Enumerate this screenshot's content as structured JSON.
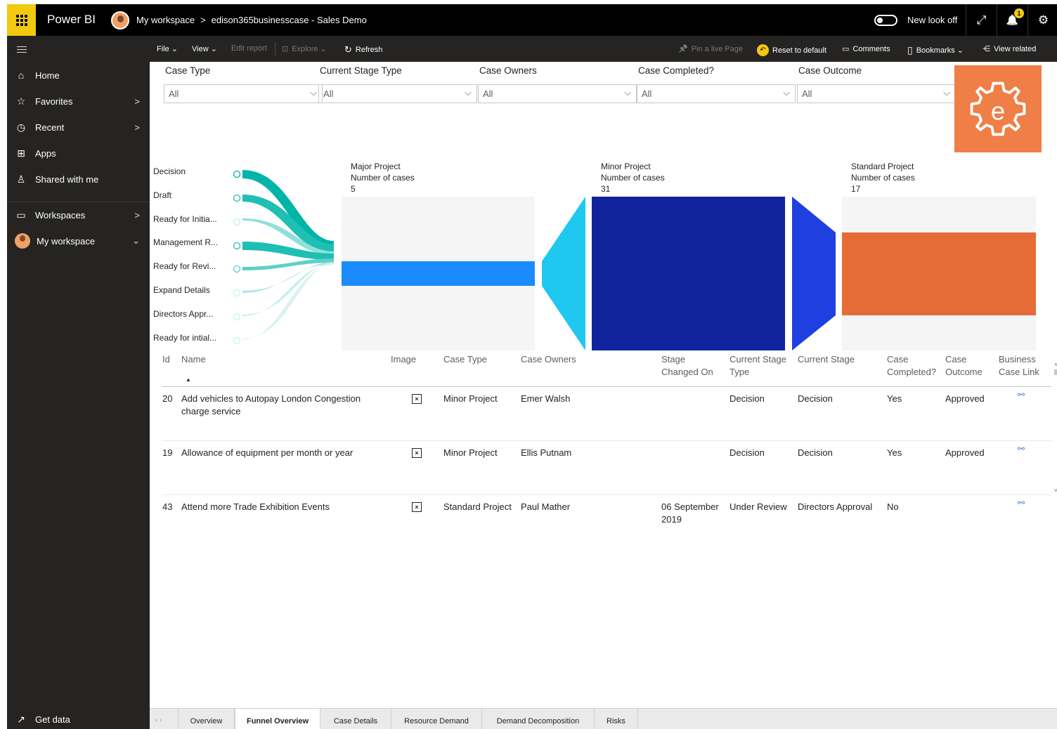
{
  "app": {
    "name": "Power BI",
    "breadcrumb": [
      "My workspace",
      "edison365businesscase - Sales Demo"
    ],
    "breadcrumb_sep": ">",
    "new_look_label": "New look off",
    "notification_count": "1",
    "expand_glyph": "⤢",
    "bell_glyph": "🔔",
    "settings_glyph": "⚙"
  },
  "nav": {
    "items": [
      {
        "label": "Home",
        "icon": "home-icon",
        "glyph": "⌂"
      },
      {
        "label": "Favorites",
        "icon": "star-icon",
        "glyph": "☆",
        "chevron": ">"
      },
      {
        "label": "Recent",
        "icon": "clock-icon",
        "glyph": "◷",
        "chevron": ">"
      },
      {
        "label": "Apps",
        "icon": "apps-icon",
        "glyph": "⊞"
      },
      {
        "label": "Shared with me",
        "icon": "share-person-icon",
        "glyph": "♙"
      },
      {
        "label": "Workspaces",
        "icon": "workspaces-icon",
        "glyph": "▭",
        "chevron": ">"
      },
      {
        "label": "My workspace",
        "icon": "avatar",
        "chevron": "⌄"
      }
    ],
    "get_data": {
      "label": "Get data",
      "glyph": "↗"
    }
  },
  "toolbar": {
    "file": "File ⌄",
    "view": "View ⌄",
    "edit_report": "Edit report",
    "explore": "Explore ⌄",
    "refresh": "Refresh",
    "refresh_glyph": "↻",
    "pin": "Pin a live Page",
    "pin_glyph": "📌",
    "reset": "Reset to default",
    "reset_glyph": "↶",
    "comments": "Comments",
    "comments_glyph": "▭",
    "bookmarks": "Bookmarks ⌄",
    "bookmarks_glyph": "▯",
    "view_related": "View related",
    "view_related_glyph": "⋲"
  },
  "slicers": [
    {
      "label": "Case Type",
      "value": "All"
    },
    {
      "label": "Current Stage Type",
      "value": "All"
    },
    {
      "label": "Case Owners",
      "value": "All"
    },
    {
      "label": "Case Completed?",
      "value": "All"
    },
    {
      "label": "Case Outcome",
      "value": "All"
    }
  ],
  "funnel": {
    "stages": [
      "Decision",
      "Draft",
      "Ready for Initia...",
      "Management R...",
      "Ready for Revi...",
      "Expand Details",
      "Directors Appr...",
      "Ready for intial..."
    ],
    "blocks": [
      {
        "title": "Major Project",
        "metric": "Number of cases",
        "value": "5",
        "color": "#1a8cff"
      },
      {
        "title": "Minor Project",
        "metric": "Number of cases",
        "value": "31",
        "color": "#12239e"
      },
      {
        "title": "Standard Project",
        "metric": "Number of cases",
        "value": "17",
        "color": "#e66c37"
      }
    ]
  },
  "table": {
    "headers": [
      {
        "key": "id",
        "label": "Id"
      },
      {
        "key": "name",
        "label": "Name"
      },
      {
        "key": "image",
        "label": "Image"
      },
      {
        "key": "case_type",
        "label": "Case Type"
      },
      {
        "key": "owners",
        "label": "Case Owners"
      },
      {
        "key": "stage_changed",
        "label": "Stage Changed On"
      },
      {
        "key": "stage_type",
        "label": "Current Stage Type"
      },
      {
        "key": "stage",
        "label": "Current Stage"
      },
      {
        "key": "completed",
        "label": "Case Completed?"
      },
      {
        "key": "outcome",
        "label": "Case Outcome"
      },
      {
        "key": "link",
        "label": "Business Case Link"
      }
    ],
    "sort_glyph": "▲",
    "rows": [
      {
        "id": "20",
        "name": "Add vehicles to Autopay London Congestion charge service",
        "case_type": "Minor Project",
        "owners": "Emer Walsh",
        "stage_changed": "",
        "stage_type": "Decision",
        "stage": "Decision",
        "completed": "Yes",
        "outcome": "Approved"
      },
      {
        "id": "19",
        "name": "Allowance of equipment per month or year",
        "case_type": "Minor Project",
        "owners": "Ellis Putnam",
        "stage_changed": "",
        "stage_type": "Decision",
        "stage": "Decision",
        "completed": "Yes",
        "outcome": "Approved"
      },
      {
        "id": "43",
        "name": "Attend more Trade Exhibition Events",
        "case_type": "Standard Project",
        "owners": "Paul Mather",
        "stage_changed": "06 September 2019",
        "stage_type": "Under Review",
        "stage": "Directors Approval",
        "completed": "No",
        "outcome": ""
      }
    ]
  },
  "tabs": [
    "Overview",
    "Funnel Overview",
    "Case Details",
    "Resource Demand",
    "Demand Decomposition",
    "Risks"
  ],
  "active_tab": "Funnel Overview",
  "tab_nav": "‹  ›",
  "colors": {
    "accent": "#f2c811",
    "logo": "#ef7e47",
    "connector": "#00b4a8",
    "funnel_mid": "#1ec8f0",
    "funnel_mid2": "#1f3fe0"
  }
}
